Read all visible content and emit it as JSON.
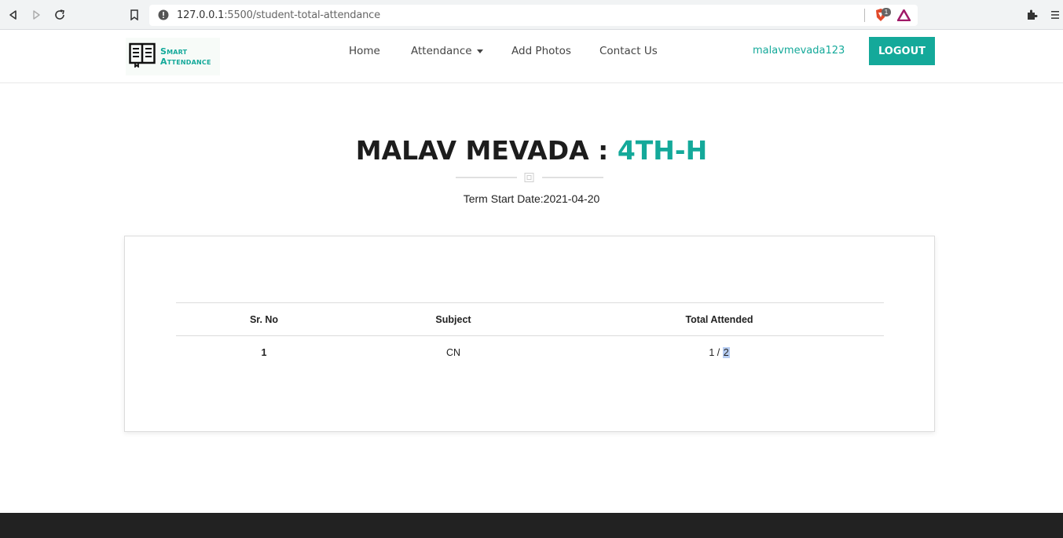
{
  "browser": {
    "url_host": "127.0.0.1",
    "url_port_path": ":5500/student-total-attendance",
    "shield_badge": "1"
  },
  "header": {
    "logo_line1": "Smart",
    "logo_line2": "Attendance",
    "nav": {
      "home": "Home",
      "attendance": "Attendance",
      "add_photos": "Add Photos",
      "contact": "Contact Us"
    },
    "username": "malavmevada123",
    "logout_label": "LOGOUT"
  },
  "page": {
    "student_name": "MALAV MEVADA :",
    "class_name": "4TH-H",
    "term_start": "Term Start Date:2021-04-20"
  },
  "table": {
    "headers": [
      "Sr. No",
      "Subject",
      "Total Attended"
    ],
    "rows": [
      {
        "sr_no": "1",
        "subject": "CN",
        "attended": "1",
        "separator": " / ",
        "total": "2"
      }
    ]
  },
  "colors": {
    "accent": "#14a99a",
    "footer": "#222222"
  }
}
